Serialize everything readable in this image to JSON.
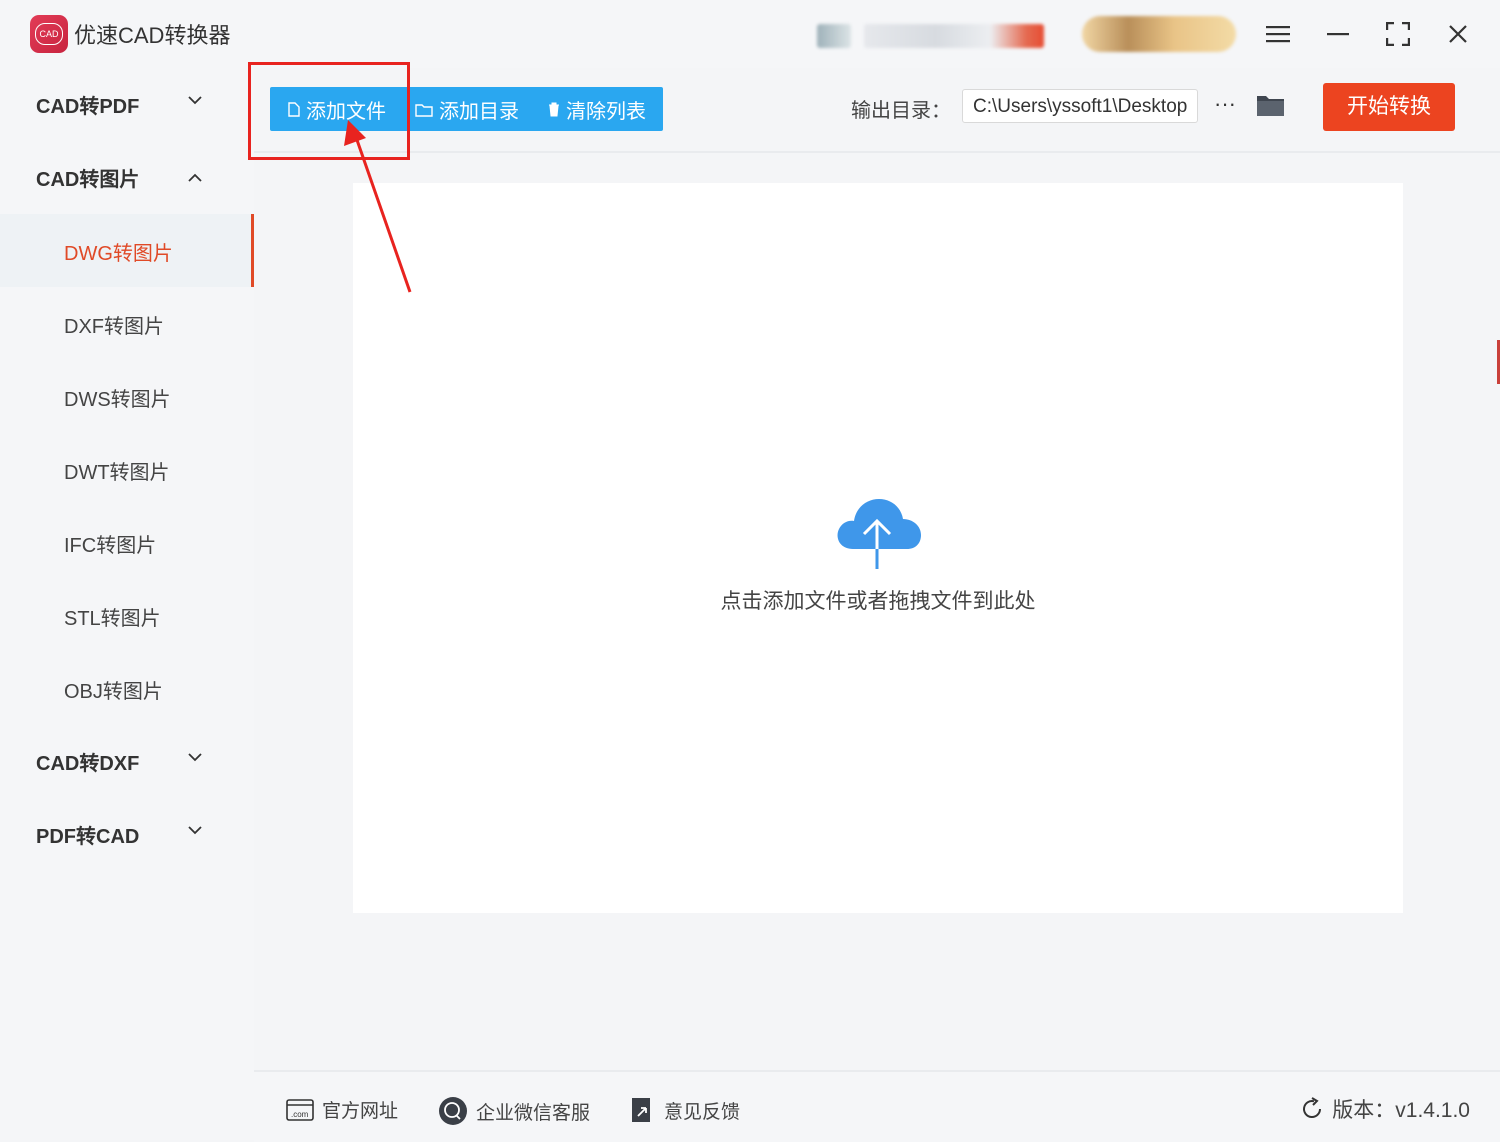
{
  "app": {
    "title": "优速CAD转换器",
    "logo_text": "CAD"
  },
  "sidebar": {
    "groups": [
      {
        "label": "CAD转PDF",
        "expanded": false
      },
      {
        "label": "CAD转图片",
        "expanded": true
      },
      {
        "label": "CAD转DXF",
        "expanded": false
      },
      {
        "label": "PDF转CAD",
        "expanded": false
      }
    ],
    "sub_items": [
      {
        "label": "DWG转图片",
        "active": true
      },
      {
        "label": "DXF转图片",
        "active": false
      },
      {
        "label": "DWS转图片",
        "active": false
      },
      {
        "label": "DWT转图片",
        "active": false
      },
      {
        "label": "IFC转图片",
        "active": false
      },
      {
        "label": "STL转图片",
        "active": false
      },
      {
        "label": "OBJ转图片",
        "active": false
      }
    ]
  },
  "toolbar": {
    "add_file": "添加文件",
    "add_folder": "添加目录",
    "clear_list": "清除列表",
    "output_label": "输出目录：",
    "output_path": "C:\\Users\\yssoft1\\Desktop",
    "more": "···",
    "start": "开始转换"
  },
  "dropzone": {
    "hint": "点击添加文件或者拖拽文件到此处"
  },
  "footer": {
    "website": "官方网址",
    "wechat": "企业微信客服",
    "feedback": "意见反馈",
    "version": "版本：v1.4.1.0"
  },
  "colors": {
    "accent_blue": "#2aa7f0",
    "accent_red": "#ec4420",
    "active_text": "#e04a27",
    "callout": "#e8231f"
  }
}
